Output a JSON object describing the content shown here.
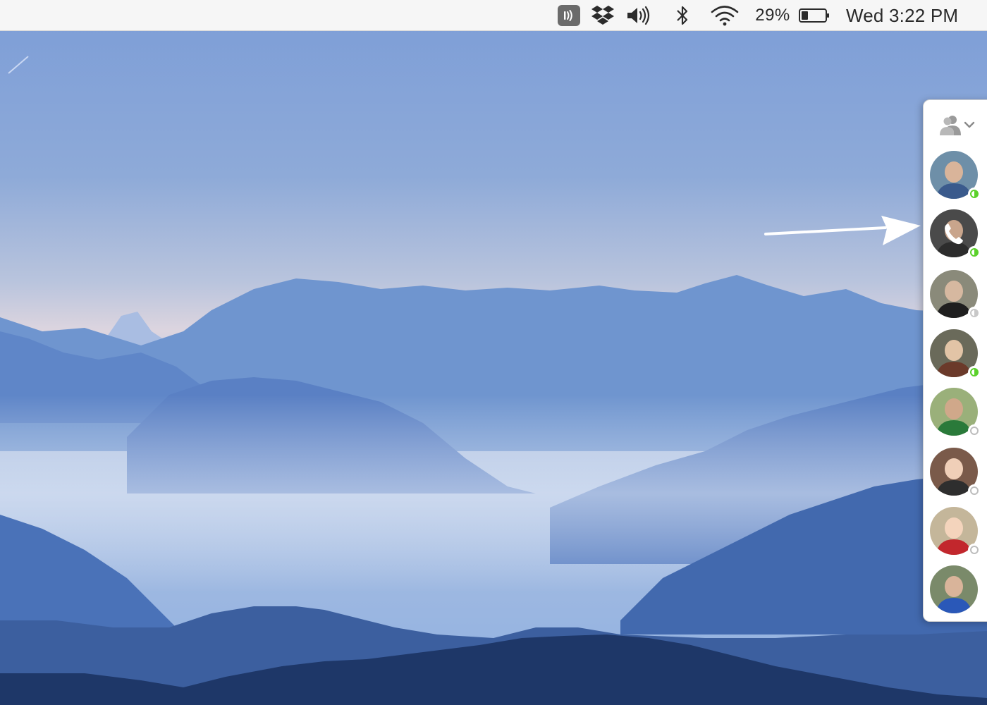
{
  "menubar": {
    "audio_badge_icon": "audio-hijack-icon",
    "dropbox_icon": "dropbox-icon",
    "volume_icon": "volume-icon",
    "bluetooth_icon": "bluetooth-icon",
    "wifi_icon": "wifi-icon",
    "battery_percent": "29%",
    "battery_level": 0.29,
    "clock": "Wed 3:22 PM"
  },
  "contacts_panel": {
    "toggle_icon": "contacts-chevron-icon",
    "contacts": [
      {
        "status": "active",
        "on_call": false,
        "colors": [
          "#6e8fa8",
          "#3a5a8c",
          "#d9b49a"
        ]
      },
      {
        "status": "active",
        "on_call": true,
        "colors": [
          "#4a4a4a",
          "#2c2c2c",
          "#c9a58c"
        ]
      },
      {
        "status": "away",
        "on_call": false,
        "colors": [
          "#8a8a7a",
          "#1f1f1f",
          "#d6b8a0"
        ]
      },
      {
        "status": "active",
        "on_call": false,
        "colors": [
          "#6a6a5a",
          "#6b3a2a",
          "#e2c4a6"
        ]
      },
      {
        "status": "offline",
        "on_call": false,
        "colors": [
          "#9ab07a",
          "#2a7a3a",
          "#d0a88a"
        ]
      },
      {
        "status": "offline",
        "on_call": false,
        "colors": [
          "#7a5a4a",
          "#2e2e2e",
          "#f0cfb8"
        ]
      },
      {
        "status": "offline",
        "on_call": false,
        "colors": [
          "#c4b69a",
          "#c2272d",
          "#f4d4bc"
        ]
      },
      {
        "status": "none",
        "on_call": false,
        "colors": [
          "#7a8a6a",
          "#2a58b8",
          "#d9b49a"
        ]
      }
    ]
  },
  "colors": {
    "sky_top": "#7f9fd6",
    "sky_horizon": "#dcd6e2",
    "mountain_far": "#6f95cf",
    "mountain_mid": "#4f78bf",
    "mountain_near": "#1e3768",
    "status_active": "#5bd12b"
  }
}
